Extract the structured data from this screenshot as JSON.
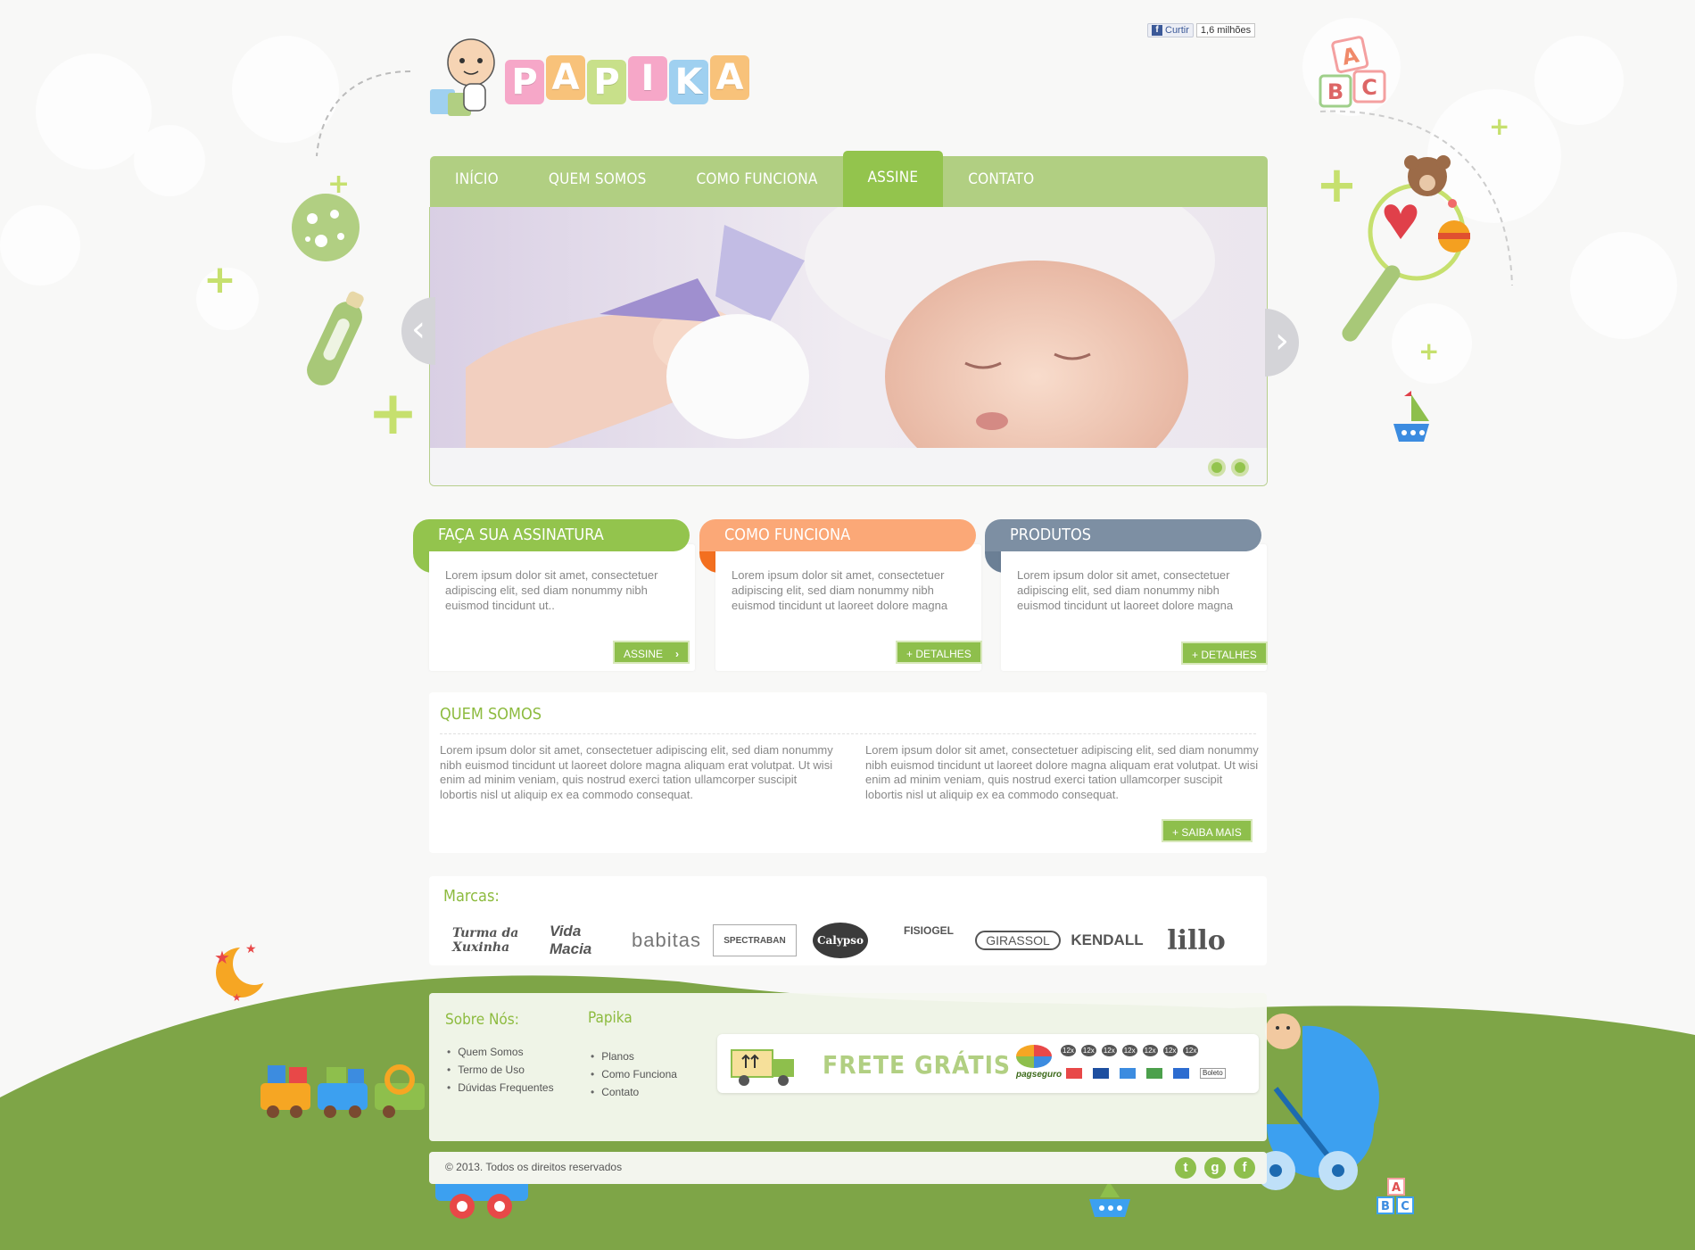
{
  "brand": {
    "name": "PAPIKA",
    "letters": [
      "P",
      "A",
      "P",
      "I",
      "K",
      "A"
    ]
  },
  "facebook": {
    "like_label": "Curtir",
    "count": "1,6 milhões",
    "icon": "facebook-icon"
  },
  "nav": {
    "items": [
      {
        "label": "INÍCIO",
        "active": false
      },
      {
        "label": "QUEM SOMOS",
        "active": false
      },
      {
        "label": "COMO FUNCIONA",
        "active": false
      },
      {
        "label": "ASSINE",
        "active": true
      },
      {
        "label": "CONTATO",
        "active": false
      }
    ]
  },
  "slider": {
    "prev_icon": "chevron-left-icon",
    "next_icon": "chevron-right-icon",
    "slide_count": 2
  },
  "boxes": [
    {
      "title": "FAÇA SUA ASSINATURA",
      "color": "#93c44d",
      "text": "Lorem ipsum dolor sit amet, consectetuer adipiscing elit, sed diam nonummy nibh euismod tincidunt ut..",
      "button": "ASSINE"
    },
    {
      "title": "COMO FUNCIONA",
      "color": "#fba877",
      "text": "Lorem ipsum dolor sit amet, consectetuer adipiscing elit, sed diam nonummy nibh euismod tincidunt ut laoreet dolore magna",
      "button": "+ DETALHES"
    },
    {
      "title": "PRODUTOS",
      "color": "#7d8fa3",
      "text": "Lorem ipsum dolor sit amet, consectetuer adipiscing elit, sed diam nonummy nibh euismod tincidunt ut laoreet dolore magna",
      "button": "+ DETALHES"
    }
  ],
  "about": {
    "title": "QUEM SOMOS",
    "col1": "Lorem ipsum dolor sit amet, consectetuer adipiscing elit, sed diam nonummy nibh euismod tincidunt ut laoreet dolore magna aliquam erat volutpat. Ut wisi enim ad minim veniam, quis nostrud exerci tation ullamcorper suscipit lobortis nisl ut aliquip ex ea commodo consequat.",
    "col2": "Lorem ipsum dolor sit amet, consectetuer adipiscing elit, sed diam nonummy nibh euismod tincidunt ut laoreet dolore magna aliquam erat volutpat. Ut wisi enim ad minim veniam, quis nostrud exerci tation ullamcorper suscipit lobortis nisl ut aliquip ex ea commodo consequat.",
    "button": "+ SAIBA MAIS"
  },
  "brands": {
    "title": "Marcas:",
    "logos": [
      "Turma da Xuxinha",
      "Vida Macia",
      "babitas",
      "SPECTRABAN",
      "Calypso",
      "FISIOGEL",
      "GIRASSOL",
      "KENDALL",
      "lillo"
    ]
  },
  "footer": {
    "col1_title": "Sobre Nós:",
    "col1_items": [
      "Quem Somos",
      "Termo de Uso",
      "Dúvidas Frequentes"
    ],
    "col2_title": "Papika",
    "col2_items": [
      "Planos",
      "Como Funciona",
      "Contato"
    ],
    "shipping": "FRETE GRÁTIS",
    "payment_brand": "pagseguro",
    "installments": [
      "12x",
      "12x",
      "12x",
      "12x",
      "12x",
      "12x",
      "12x"
    ],
    "boleto": "Boleto",
    "copyright": "© 2013. Todos os direitos reservados",
    "social": [
      {
        "name": "twitter-icon",
        "glyph": "t"
      },
      {
        "name": "google-icon",
        "glyph": "g"
      },
      {
        "name": "facebook-icon",
        "glyph": "f"
      }
    ]
  },
  "colors": {
    "green": "#93c44d",
    "nav_green": "#b1cf82",
    "orange": "#fba877",
    "slate": "#7d8fa3",
    "hill": "#7ea547"
  }
}
